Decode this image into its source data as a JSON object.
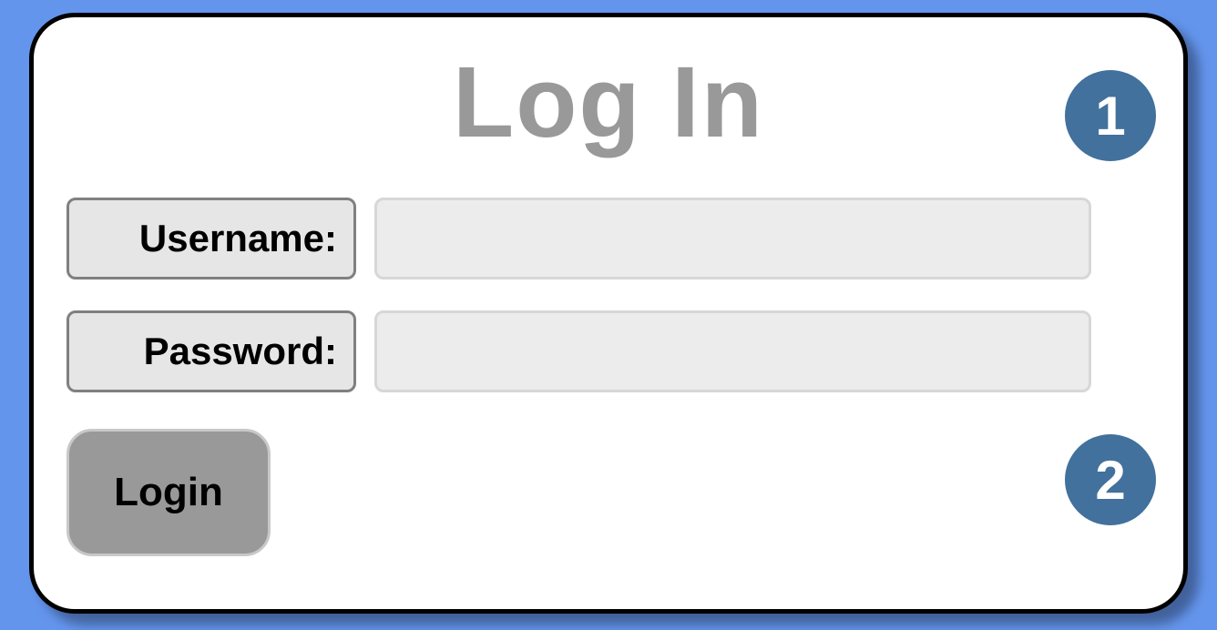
{
  "title": "Log In",
  "form": {
    "username": {
      "label": "Username:",
      "value": ""
    },
    "password": {
      "label": "Password:",
      "value": ""
    }
  },
  "button": {
    "login": "Login"
  },
  "callouts": {
    "one": "1",
    "two": "2"
  },
  "colors": {
    "background": "#6495ed",
    "panel_bg": "#ffffff",
    "panel_border": "#000000",
    "title_text": "#999999",
    "label_bg": "#e6e6e6",
    "label_border": "#808080",
    "input_bg": "#ececec",
    "input_border": "#d7d7d7",
    "button_bg": "#999999",
    "button_border": "#c8c8c8",
    "callout_bg": "#41719c",
    "callout_text": "#ffffff"
  }
}
